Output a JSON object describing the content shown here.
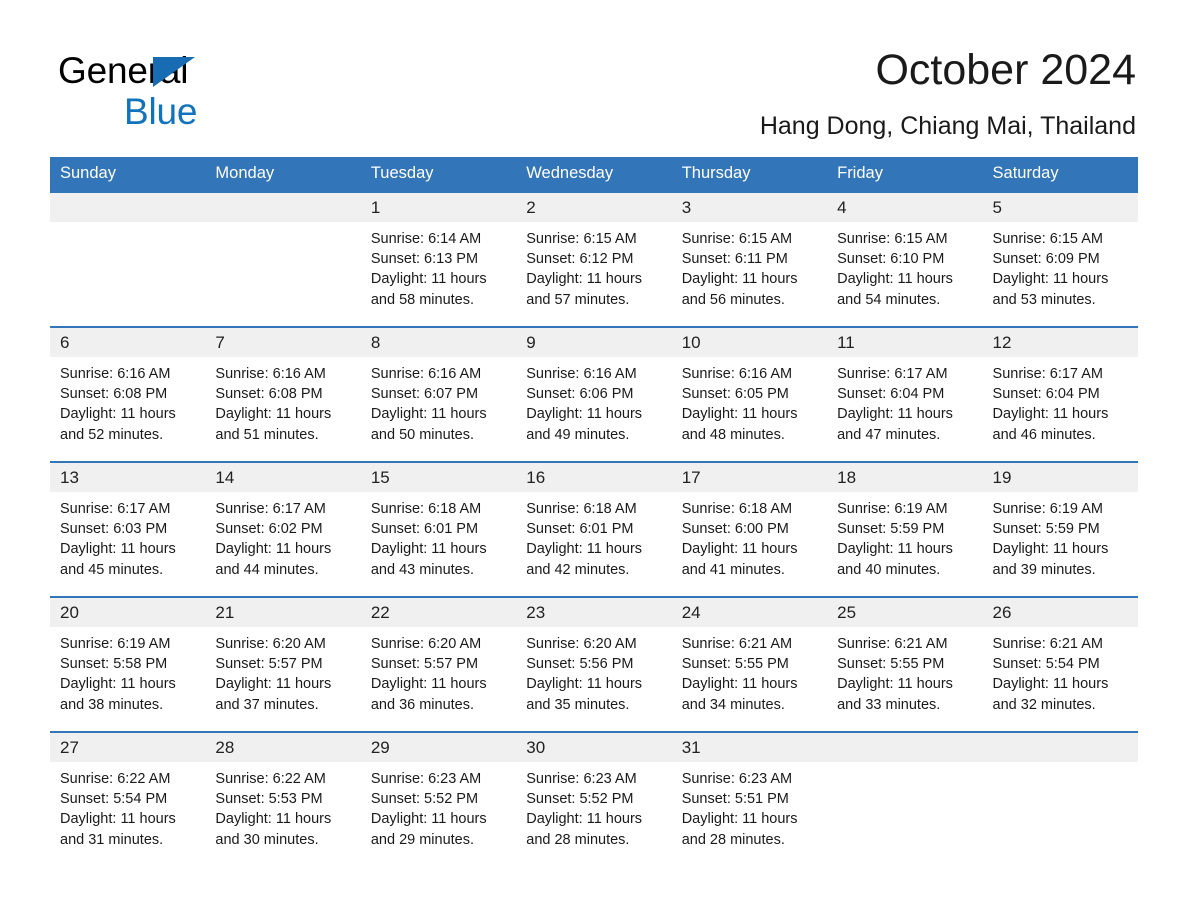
{
  "brand": {
    "name_part1": "General",
    "name_part2": "Blue",
    "triangle_color": "#176cb4",
    "blue_text_color": "#1273bd"
  },
  "header": {
    "title": "October 2024",
    "location": "Hang Dong, Chiang Mai, Thailand",
    "accent_color": "#3275b8",
    "daynum_band_color": "#f0f0f0"
  },
  "weekday_headers": [
    "Sunday",
    "Monday",
    "Tuesday",
    "Wednesday",
    "Thursday",
    "Friday",
    "Saturday"
  ],
  "weeks": [
    [
      {
        "day": "",
        "sunrise": "",
        "sunset": "",
        "daylight_line1": "",
        "daylight_line2": ""
      },
      {
        "day": "",
        "sunrise": "",
        "sunset": "",
        "daylight_line1": "",
        "daylight_line2": ""
      },
      {
        "day": "1",
        "sunrise": "Sunrise: 6:14 AM",
        "sunset": "Sunset: 6:13 PM",
        "daylight_line1": "Daylight: 11 hours",
        "daylight_line2": "and 58 minutes."
      },
      {
        "day": "2",
        "sunrise": "Sunrise: 6:15 AM",
        "sunset": "Sunset: 6:12 PM",
        "daylight_line1": "Daylight: 11 hours",
        "daylight_line2": "and 57 minutes."
      },
      {
        "day": "3",
        "sunrise": "Sunrise: 6:15 AM",
        "sunset": "Sunset: 6:11 PM",
        "daylight_line1": "Daylight: 11 hours",
        "daylight_line2": "and 56 minutes."
      },
      {
        "day": "4",
        "sunrise": "Sunrise: 6:15 AM",
        "sunset": "Sunset: 6:10 PM",
        "daylight_line1": "Daylight: 11 hours",
        "daylight_line2": "and 54 minutes."
      },
      {
        "day": "5",
        "sunrise": "Sunrise: 6:15 AM",
        "sunset": "Sunset: 6:09 PM",
        "daylight_line1": "Daylight: 11 hours",
        "daylight_line2": "and 53 minutes."
      }
    ],
    [
      {
        "day": "6",
        "sunrise": "Sunrise: 6:16 AM",
        "sunset": "Sunset: 6:08 PM",
        "daylight_line1": "Daylight: 11 hours",
        "daylight_line2": "and 52 minutes."
      },
      {
        "day": "7",
        "sunrise": "Sunrise: 6:16 AM",
        "sunset": "Sunset: 6:08 PM",
        "daylight_line1": "Daylight: 11 hours",
        "daylight_line2": "and 51 minutes."
      },
      {
        "day": "8",
        "sunrise": "Sunrise: 6:16 AM",
        "sunset": "Sunset: 6:07 PM",
        "daylight_line1": "Daylight: 11 hours",
        "daylight_line2": "and 50 minutes."
      },
      {
        "day": "9",
        "sunrise": "Sunrise: 6:16 AM",
        "sunset": "Sunset: 6:06 PM",
        "daylight_line1": "Daylight: 11 hours",
        "daylight_line2": "and 49 minutes."
      },
      {
        "day": "10",
        "sunrise": "Sunrise: 6:16 AM",
        "sunset": "Sunset: 6:05 PM",
        "daylight_line1": "Daylight: 11 hours",
        "daylight_line2": "and 48 minutes."
      },
      {
        "day": "11",
        "sunrise": "Sunrise: 6:17 AM",
        "sunset": "Sunset: 6:04 PM",
        "daylight_line1": "Daylight: 11 hours",
        "daylight_line2": "and 47 minutes."
      },
      {
        "day": "12",
        "sunrise": "Sunrise: 6:17 AM",
        "sunset": "Sunset: 6:04 PM",
        "daylight_line1": "Daylight: 11 hours",
        "daylight_line2": "and 46 minutes."
      }
    ],
    [
      {
        "day": "13",
        "sunrise": "Sunrise: 6:17 AM",
        "sunset": "Sunset: 6:03 PM",
        "daylight_line1": "Daylight: 11 hours",
        "daylight_line2": "and 45 minutes."
      },
      {
        "day": "14",
        "sunrise": "Sunrise: 6:17 AM",
        "sunset": "Sunset: 6:02 PM",
        "daylight_line1": "Daylight: 11 hours",
        "daylight_line2": "and 44 minutes."
      },
      {
        "day": "15",
        "sunrise": "Sunrise: 6:18 AM",
        "sunset": "Sunset: 6:01 PM",
        "daylight_line1": "Daylight: 11 hours",
        "daylight_line2": "and 43 minutes."
      },
      {
        "day": "16",
        "sunrise": "Sunrise: 6:18 AM",
        "sunset": "Sunset: 6:01 PM",
        "daylight_line1": "Daylight: 11 hours",
        "daylight_line2": "and 42 minutes."
      },
      {
        "day": "17",
        "sunrise": "Sunrise: 6:18 AM",
        "sunset": "Sunset: 6:00 PM",
        "daylight_line1": "Daylight: 11 hours",
        "daylight_line2": "and 41 minutes."
      },
      {
        "day": "18",
        "sunrise": "Sunrise: 6:19 AM",
        "sunset": "Sunset: 5:59 PM",
        "daylight_line1": "Daylight: 11 hours",
        "daylight_line2": "and 40 minutes."
      },
      {
        "day": "19",
        "sunrise": "Sunrise: 6:19 AM",
        "sunset": "Sunset: 5:59 PM",
        "daylight_line1": "Daylight: 11 hours",
        "daylight_line2": "and 39 minutes."
      }
    ],
    [
      {
        "day": "20",
        "sunrise": "Sunrise: 6:19 AM",
        "sunset": "Sunset: 5:58 PM",
        "daylight_line1": "Daylight: 11 hours",
        "daylight_line2": "and 38 minutes."
      },
      {
        "day": "21",
        "sunrise": "Sunrise: 6:20 AM",
        "sunset": "Sunset: 5:57 PM",
        "daylight_line1": "Daylight: 11 hours",
        "daylight_line2": "and 37 minutes."
      },
      {
        "day": "22",
        "sunrise": "Sunrise: 6:20 AM",
        "sunset": "Sunset: 5:57 PM",
        "daylight_line1": "Daylight: 11 hours",
        "daylight_line2": "and 36 minutes."
      },
      {
        "day": "23",
        "sunrise": "Sunrise: 6:20 AM",
        "sunset": "Sunset: 5:56 PM",
        "daylight_line1": "Daylight: 11 hours",
        "daylight_line2": "and 35 minutes."
      },
      {
        "day": "24",
        "sunrise": "Sunrise: 6:21 AM",
        "sunset": "Sunset: 5:55 PM",
        "daylight_line1": "Daylight: 11 hours",
        "daylight_line2": "and 34 minutes."
      },
      {
        "day": "25",
        "sunrise": "Sunrise: 6:21 AM",
        "sunset": "Sunset: 5:55 PM",
        "daylight_line1": "Daylight: 11 hours",
        "daylight_line2": "and 33 minutes."
      },
      {
        "day": "26",
        "sunrise": "Sunrise: 6:21 AM",
        "sunset": "Sunset: 5:54 PM",
        "daylight_line1": "Daylight: 11 hours",
        "daylight_line2": "and 32 minutes."
      }
    ],
    [
      {
        "day": "27",
        "sunrise": "Sunrise: 6:22 AM",
        "sunset": "Sunset: 5:54 PM",
        "daylight_line1": "Daylight: 11 hours",
        "daylight_line2": "and 31 minutes."
      },
      {
        "day": "28",
        "sunrise": "Sunrise: 6:22 AM",
        "sunset": "Sunset: 5:53 PM",
        "daylight_line1": "Daylight: 11 hours",
        "daylight_line2": "and 30 minutes."
      },
      {
        "day": "29",
        "sunrise": "Sunrise: 6:23 AM",
        "sunset": "Sunset: 5:52 PM",
        "daylight_line1": "Daylight: 11 hours",
        "daylight_line2": "and 29 minutes."
      },
      {
        "day": "30",
        "sunrise": "Sunrise: 6:23 AM",
        "sunset": "Sunset: 5:52 PM",
        "daylight_line1": "Daylight: 11 hours",
        "daylight_line2": "and 28 minutes."
      },
      {
        "day": "31",
        "sunrise": "Sunrise: 6:23 AM",
        "sunset": "Sunset: 5:51 PM",
        "daylight_line1": "Daylight: 11 hours",
        "daylight_line2": "and 28 minutes."
      },
      {
        "day": "",
        "sunrise": "",
        "sunset": "",
        "daylight_line1": "",
        "daylight_line2": ""
      },
      {
        "day": "",
        "sunrise": "",
        "sunset": "",
        "daylight_line1": "",
        "daylight_line2": ""
      }
    ]
  ]
}
